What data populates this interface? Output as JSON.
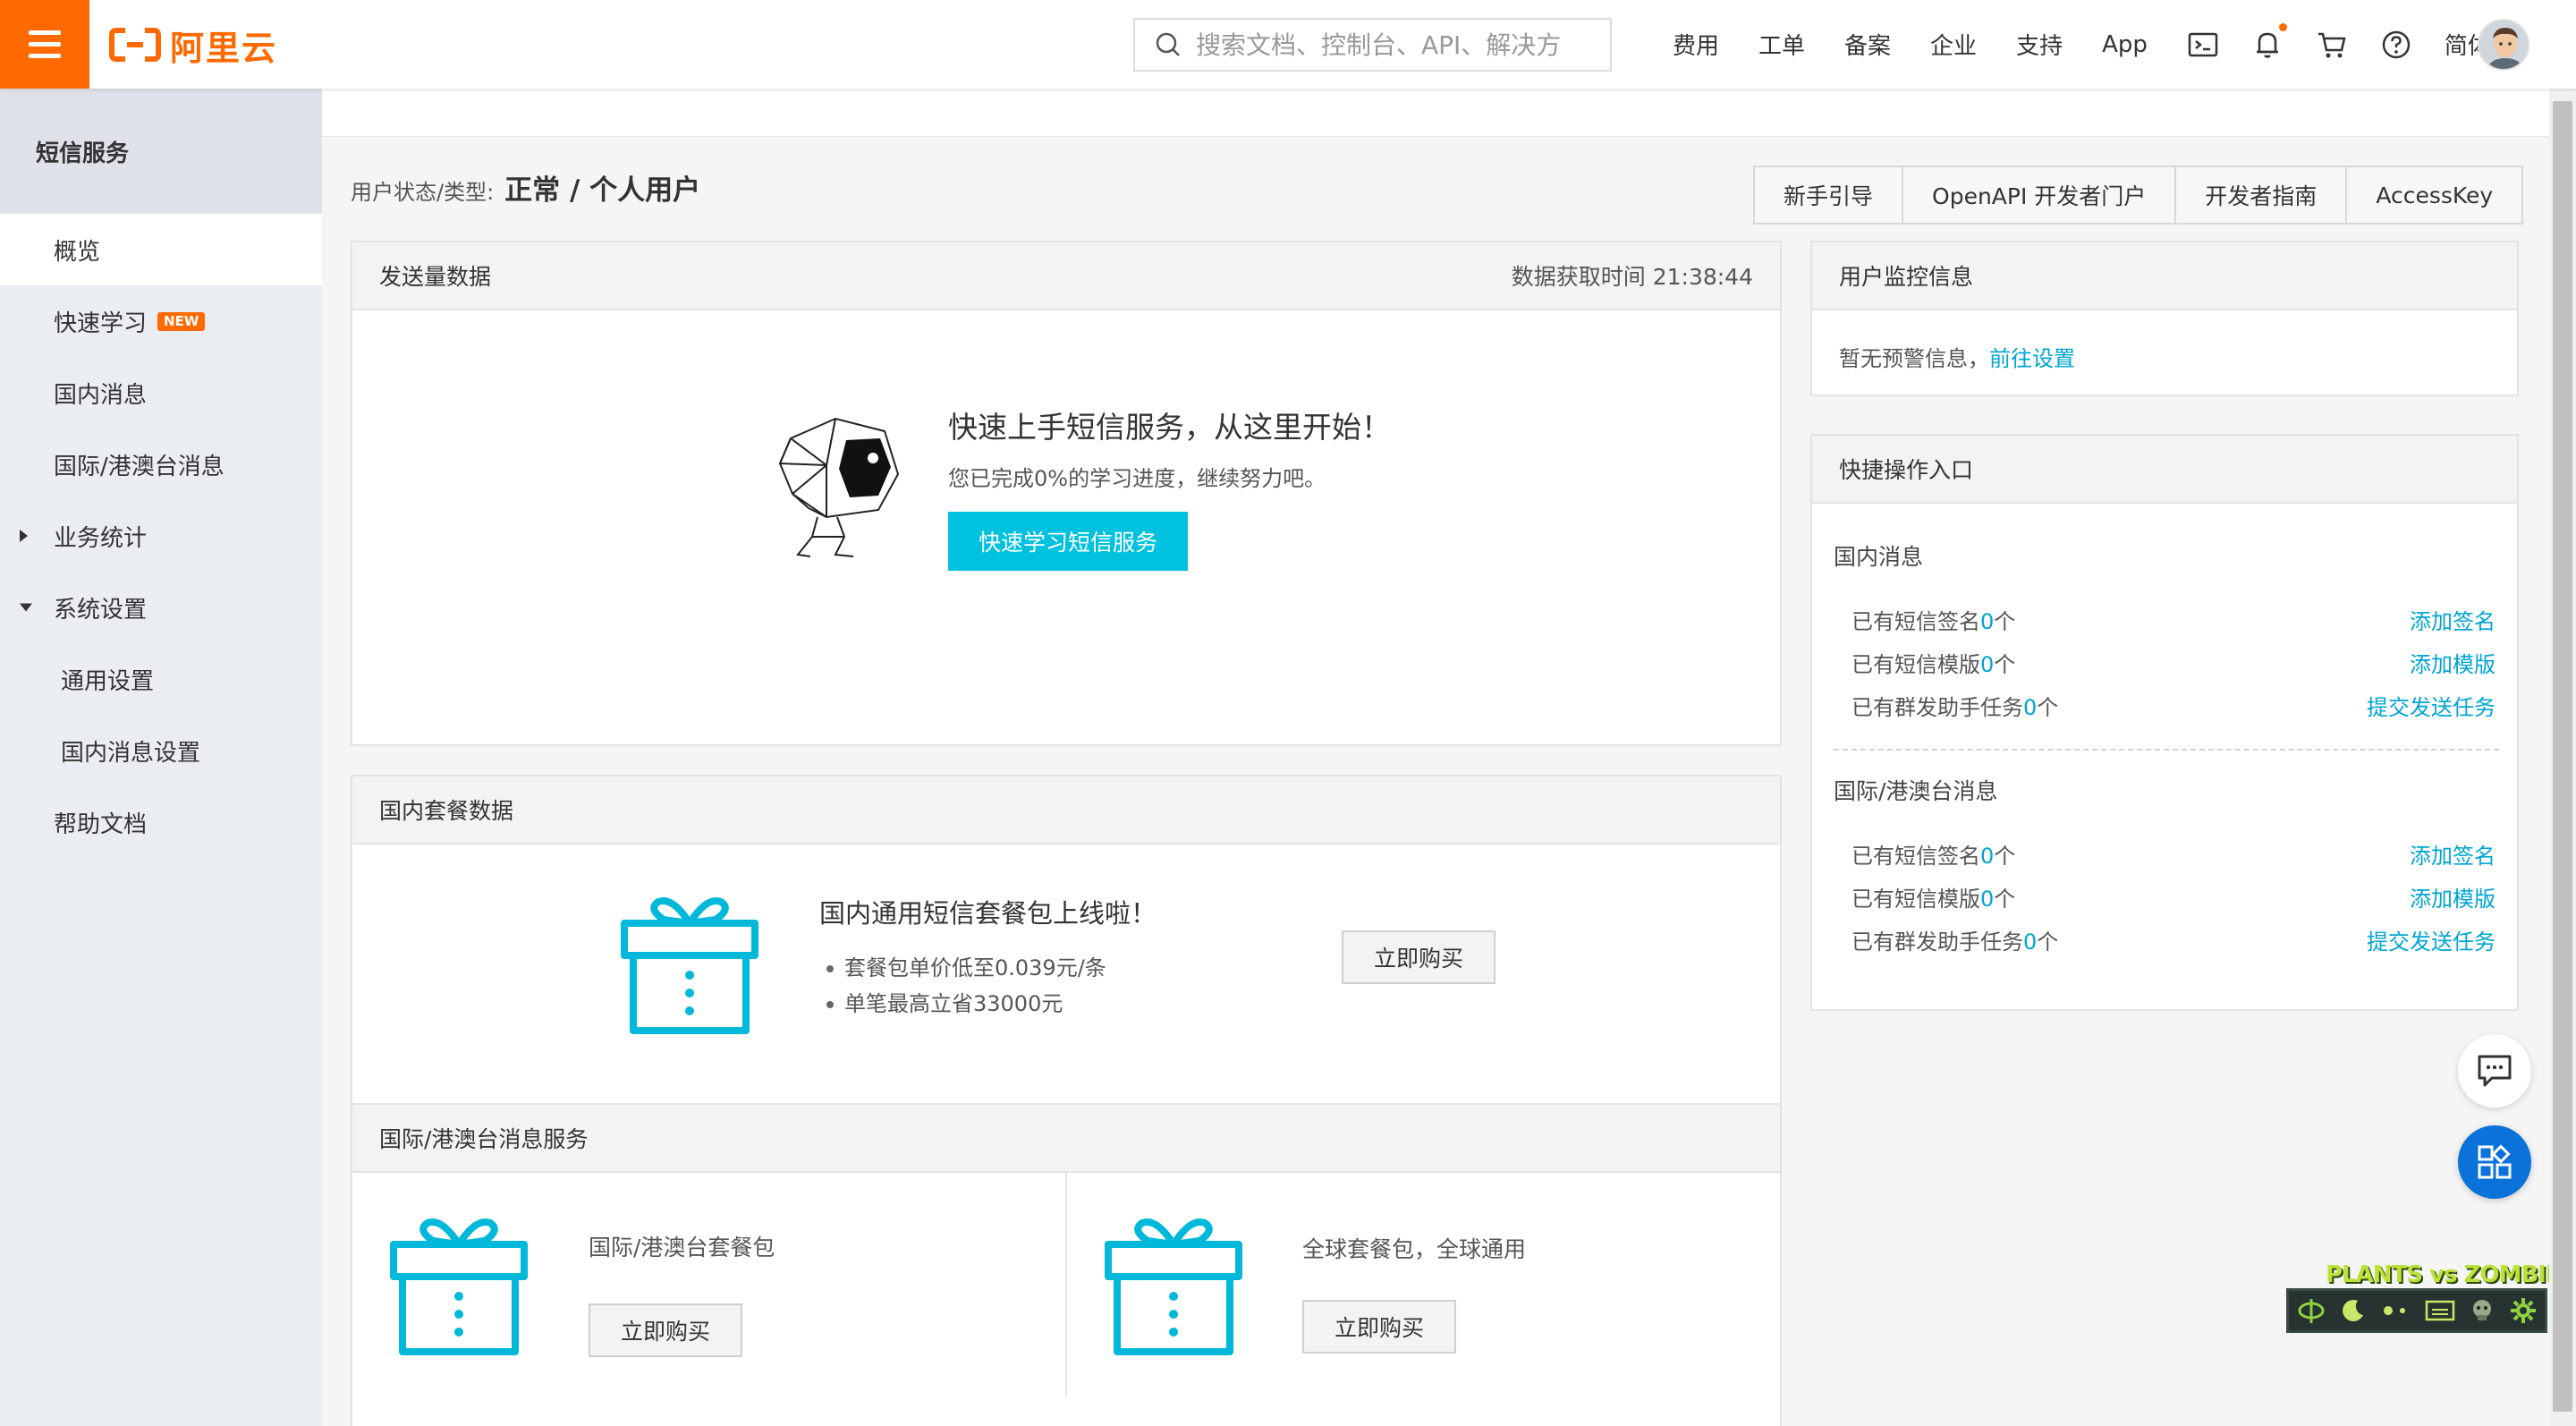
{
  "topbar": {
    "brand": "阿里云",
    "search_placeholder": "搜索文档、控制台、API、解决方",
    "nav": [
      "费用",
      "工单",
      "备案",
      "企业",
      "支持",
      "App"
    ],
    "lang": "简体",
    "brand_color": "#ff6a00",
    "icons": [
      "terminal-icon",
      "bell-icon",
      "cart-icon",
      "help-icon"
    ]
  },
  "sidebar": {
    "title": "短信服务",
    "items": [
      {
        "label": "概览",
        "active": true
      },
      {
        "label": "快速学习",
        "tag": "NEW"
      },
      {
        "label": "国内消息"
      },
      {
        "label": "国际/港澳台消息"
      },
      {
        "label": "业务统计",
        "expandable": true,
        "expanded": false
      },
      {
        "label": "系统设置",
        "expandable": true,
        "expanded": true
      },
      {
        "label": "通用设置",
        "sub": true
      },
      {
        "label": "国内消息设置",
        "sub": true
      },
      {
        "label": "帮助文档"
      }
    ]
  },
  "main": {
    "user_status_label": "用户状态/类型:",
    "user_status_value": "正常 / 个人用户",
    "header_buttons": [
      "新手引导",
      "OpenAPI 开发者门户",
      "开发者指南",
      "AccessKey"
    ],
    "send_panel": {
      "title": "发送量数据",
      "fetch_time": "数据获取时间 21:38:44",
      "promo_title": "快速上手短信服务，从这里开始！",
      "promo_sub": "您已完成0%的学习进度，继续努力吧。",
      "promo_button": "快速学习短信服务"
    },
    "domestic_pkg": {
      "title": "国内套餐数据",
      "headline": "国内通用短信套餐包上线啦！",
      "bullets": [
        "套餐包单价低至0.039元/条",
        "单笔最高立省33000元"
      ],
      "buy": "立即购买"
    },
    "intl_pkg": {
      "title": "国际/港澳台消息服务",
      "left_text": "国际/港澳台套餐包",
      "left_buy": "立即购买",
      "right_text": "全球套餐包，全球通用",
      "right_buy": "立即购买"
    },
    "monitor": {
      "title": "用户监控信息",
      "text": "暂无预警信息，",
      "link": "前往设置"
    },
    "quick": {
      "title": "快捷操作入口",
      "domestic_title": "国内消息",
      "intl_title": "国际/港澳台消息",
      "domestic_rows": [
        {
          "prefix": "已有短信签名",
          "count": "0",
          "suffix": "个",
          "action": "添加签名"
        },
        {
          "prefix": "已有短信模版",
          "count": "0",
          "suffix": "个",
          "action": "添加模版"
        },
        {
          "prefix": "已有群发助手任务",
          "count": "0",
          "suffix": "个",
          "action": "提交发送任务"
        }
      ],
      "intl_rows": [
        {
          "prefix": "已有短信签名",
          "count": "0",
          "suffix": "个",
          "action": "添加签名"
        },
        {
          "prefix": "已有短信模版",
          "count": "0",
          "suffix": "个",
          "action": "添加模版"
        },
        {
          "prefix": "已有群发助手任务",
          "count": "0",
          "suffix": "个",
          "action": "提交发送任务"
        }
      ]
    }
  },
  "overlay": {
    "pvz_logo": "PLANTS vs ZOMBIES"
  },
  "colors": {
    "accent": "#00c1de",
    "link": "#00a4d3",
    "float_blue": "#0a72d8"
  }
}
